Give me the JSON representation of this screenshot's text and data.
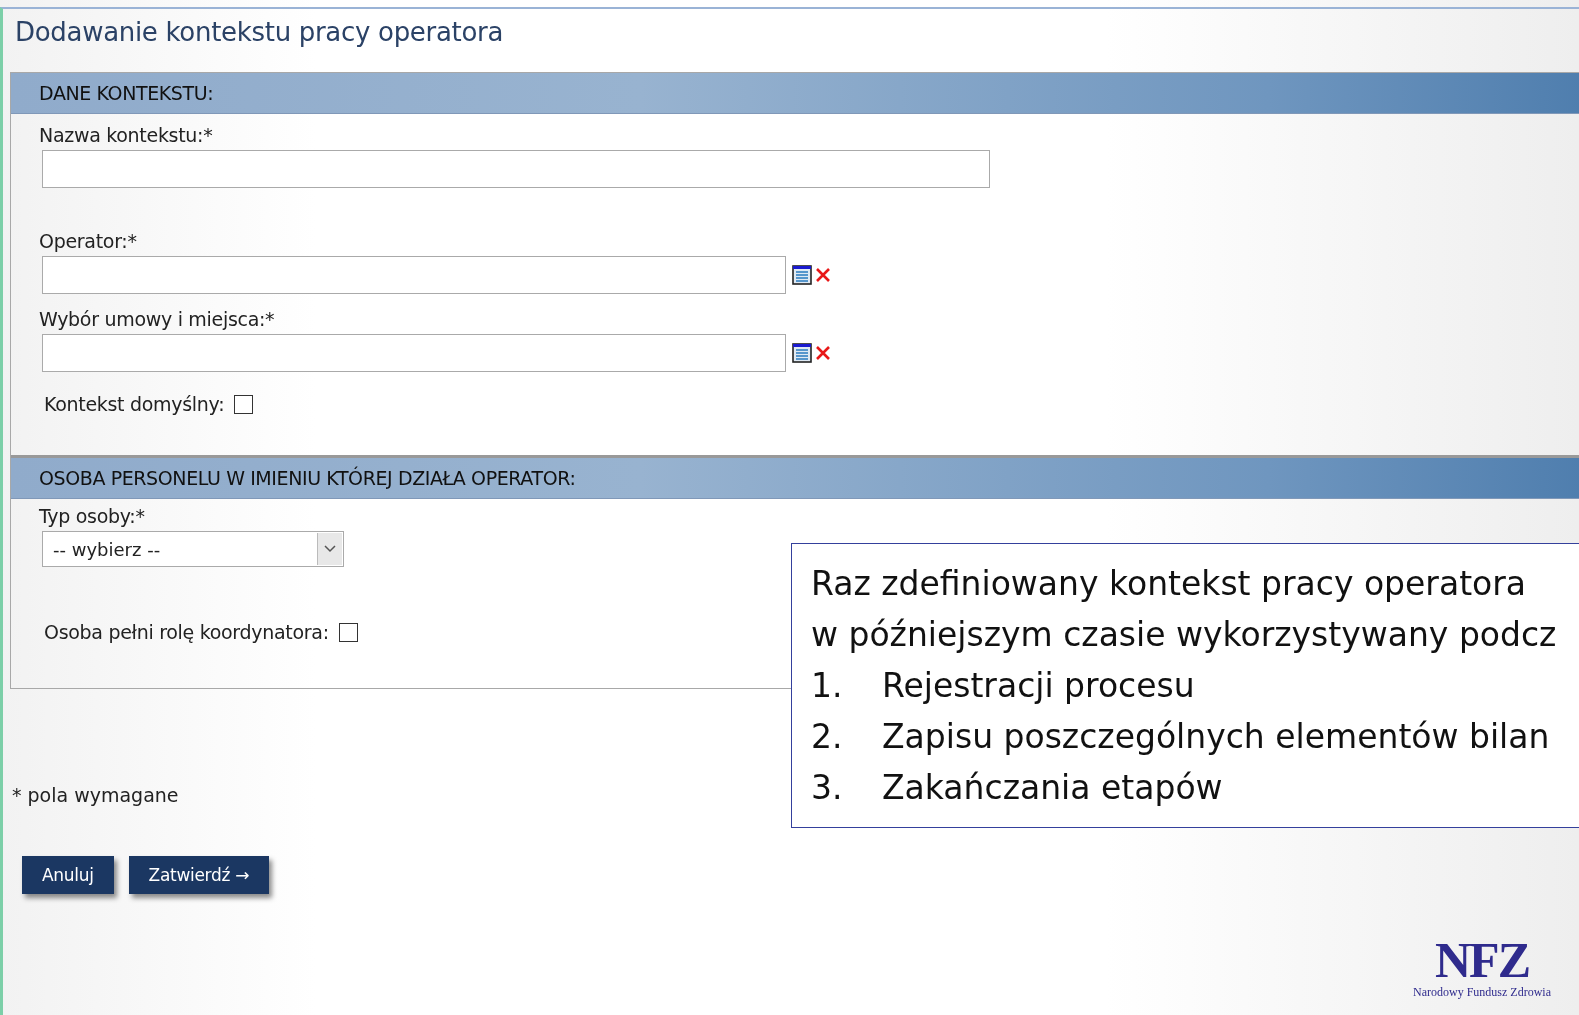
{
  "page_title": "Dodawanie kontekstu pracy operatora",
  "sections": [
    {
      "heading": "DANE KONTEKSTU:",
      "fields": [
        {
          "kind": "text",
          "label": "Nazwa kontekstu:*"
        },
        {
          "kind": "lookup",
          "label": "Operator:*"
        },
        {
          "kind": "lookup",
          "label": "Wybór umowy i miejsca:*"
        },
        {
          "kind": "checkbox",
          "label": "Kontekst domyślny:",
          "checked": false
        }
      ]
    },
    {
      "heading": "OSOBA PERSONELU W IMIENIU KTÓREJ DZIAŁA OPERATOR:",
      "fields": [
        {
          "kind": "select",
          "label": "Typ osoby:*",
          "value": "-- wybierz --"
        },
        {
          "kind": "checkbox",
          "label": "Osoba pełni rolę koordynatora:",
          "checked": false
        }
      ]
    }
  ],
  "required_note": "* pola wymagane",
  "buttons": [
    {
      "label": "Anuluj"
    },
    {
      "label": "Zatwierdź",
      "arrow": "→"
    }
  ],
  "callout": {
    "lines": [
      "Raz zdefiniowany kontekst pracy operatora",
      "w późniejszym czasie wykorzystywany podcz"
    ],
    "items": [
      {
        "number": "1.",
        "text": "Rejestracji procesu"
      },
      {
        "number": "2.",
        "text": "Zapisu poszczególnych elementów bilan"
      },
      {
        "number": "3.",
        "text": "Zakańczania etapów"
      }
    ]
  },
  "logo": {
    "mark": "NFZ",
    "caption": "Narodowy Fundusz Zdrowia"
  }
}
